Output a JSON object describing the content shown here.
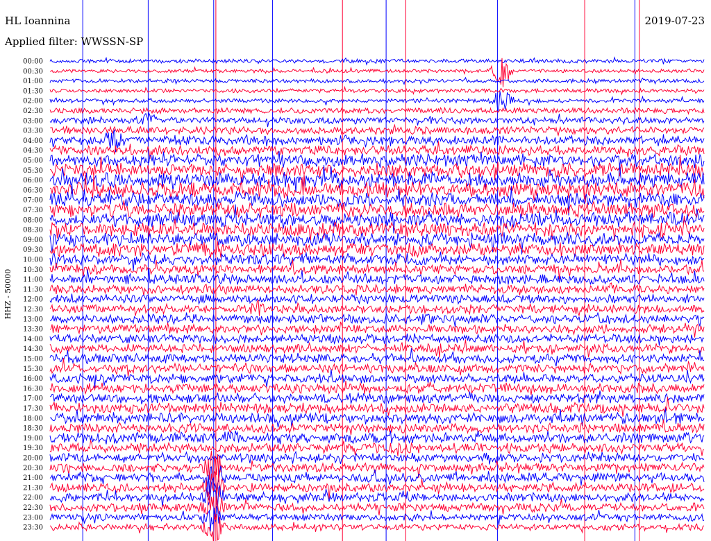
{
  "header": {
    "station": "HL Ioannina",
    "filter_text": "Applied filter: WWSSN-SP",
    "date": "2019-07-23"
  },
  "chart_data": {
    "type": "line",
    "title": "HL Ioannina",
    "subtitle": "Applied filter: WWSSN-SP",
    "date": "2019-07-23",
    "ylabel": "HHZ - 50000",
    "row_labels": [
      "00:00",
      "00:30",
      "01:00",
      "01:30",
      "02:00",
      "02:30",
      "03:00",
      "03:30",
      "04:00",
      "04:30",
      "05:00",
      "05:30",
      "06:00",
      "06:30",
      "07:00",
      "07:30",
      "08:00",
      "08:30",
      "09:00",
      "09:30",
      "10:00",
      "10:30",
      "11:00",
      "11:30",
      "12:00",
      "12:30",
      "13:00",
      "13:30",
      "14:00",
      "14:30",
      "15:00",
      "15:30",
      "16:00",
      "16:30",
      "17:00",
      "17:30",
      "18:00",
      "18:30",
      "19:00",
      "19:30",
      "20:00",
      "20:30",
      "21:00",
      "21:30",
      "22:00",
      "22:30",
      "23:00",
      "23:30"
    ],
    "trace_colors": [
      "#0000ff",
      "#ff0033"
    ],
    "noise_level": [
      0.2,
      0.15,
      0.2,
      0.2,
      0.2,
      0.4,
      0.5,
      0.6,
      0.8,
      0.9,
      1.2,
      1.3,
      1.5,
      1.5,
      1.4,
      1.4,
      1.4,
      1.4,
      1.3,
      1.3,
      1.0,
      0.9,
      0.9,
      0.8,
      0.8,
      0.8,
      0.8,
      0.8,
      0.8,
      0.8,
      0.8,
      0.8,
      0.8,
      0.9,
      0.9,
      0.9,
      1.0,
      0.9,
      0.9,
      0.9,
      0.8,
      0.8,
      0.8,
      0.8,
      0.8,
      0.7,
      0.6,
      0.5
    ],
    "minutes_per_row": 30,
    "vertical_markers": [
      {
        "minute": 1.5,
        "color": "#0000ff"
      },
      {
        "minute": 4.5,
        "color": "#0000ff"
      },
      {
        "minute": 7.5,
        "color": "#0000ff"
      },
      {
        "minute": 7.6,
        "color": "#ff0033"
      },
      {
        "minute": 10.2,
        "color": "#0000ff"
      },
      {
        "minute": 13.4,
        "color": "#ff0033"
      },
      {
        "minute": 15.4,
        "color": "#0000ff"
      },
      {
        "minute": 16.3,
        "color": "#ff0033"
      },
      {
        "minute": 20.5,
        "color": "#0000ff"
      },
      {
        "minute": 24.5,
        "color": "#ff0033"
      },
      {
        "minute": 26.8,
        "color": "#0000ff"
      },
      {
        "minute": 27.0,
        "color": "#ff0033"
      }
    ],
    "events": [
      {
        "row": 1,
        "minute": 20.7,
        "amp": 24
      },
      {
        "row": 4,
        "minute": 20.7,
        "amp": 20
      },
      {
        "row": 6,
        "minute": 4.5,
        "amp": 8
      },
      {
        "row": 8,
        "minute": 3.0,
        "amp": 14
      },
      {
        "row": 19,
        "minute": 7.5,
        "amp": 10
      },
      {
        "row": 25,
        "minute": 9.5,
        "amp": 8
      },
      {
        "row": 38,
        "minute": 8.4,
        "amp": 9
      },
      {
        "row": 41,
        "minute": 7.5,
        "amp": 22
      },
      {
        "row": 42,
        "minute": 7.5,
        "amp": 26
      },
      {
        "row": 43,
        "minute": 7.5,
        "amp": 22
      },
      {
        "row": 44,
        "minute": 7.5,
        "amp": 24
      },
      {
        "row": 45,
        "minute": 7.5,
        "amp": 24
      },
      {
        "row": 46,
        "minute": 7.5,
        "amp": 22
      },
      {
        "row": 47,
        "minute": 7.5,
        "amp": 22
      }
    ]
  }
}
